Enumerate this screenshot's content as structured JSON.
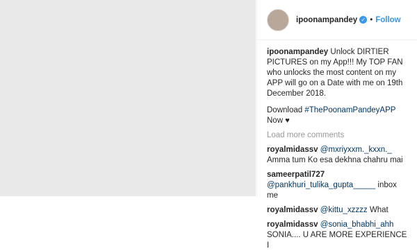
{
  "post": {
    "username": "ipoonampandey",
    "follow_label": "Follow",
    "dot": "•",
    "verified_glyph": "✓"
  },
  "caption": {
    "username": "ipoonampandey",
    "text": "Unlock DIRTIER PICTURES on my App!!! My TOP FAN who unlocks the most content on my APP will go on a Date with me on 19th December 2018.",
    "download_prefix": "Download",
    "hashtag": "#ThePoonamPandeyAPP",
    "download_suffix": "Now",
    "heart": "♥"
  },
  "load_more_label": "Load more comments",
  "comments": [
    {
      "username": "royalmidassv",
      "mention": "@mxriyxxm._kxxn._",
      "text": "Amma tum Ko esa dekhna chahru mai"
    },
    {
      "username": "sameerpatil727",
      "mention": "@pankhuri_tulika_gupta_____",
      "text": "inbox me"
    },
    {
      "username": "royalmidassv",
      "mention": "@kittu_xzzzz",
      "text": "What"
    },
    {
      "username": "royalmidassv",
      "mention": "@sonia_bhabhi_ahh",
      "text": "SONIA.... U ARE MORE EXPERIENCE I"
    }
  ]
}
